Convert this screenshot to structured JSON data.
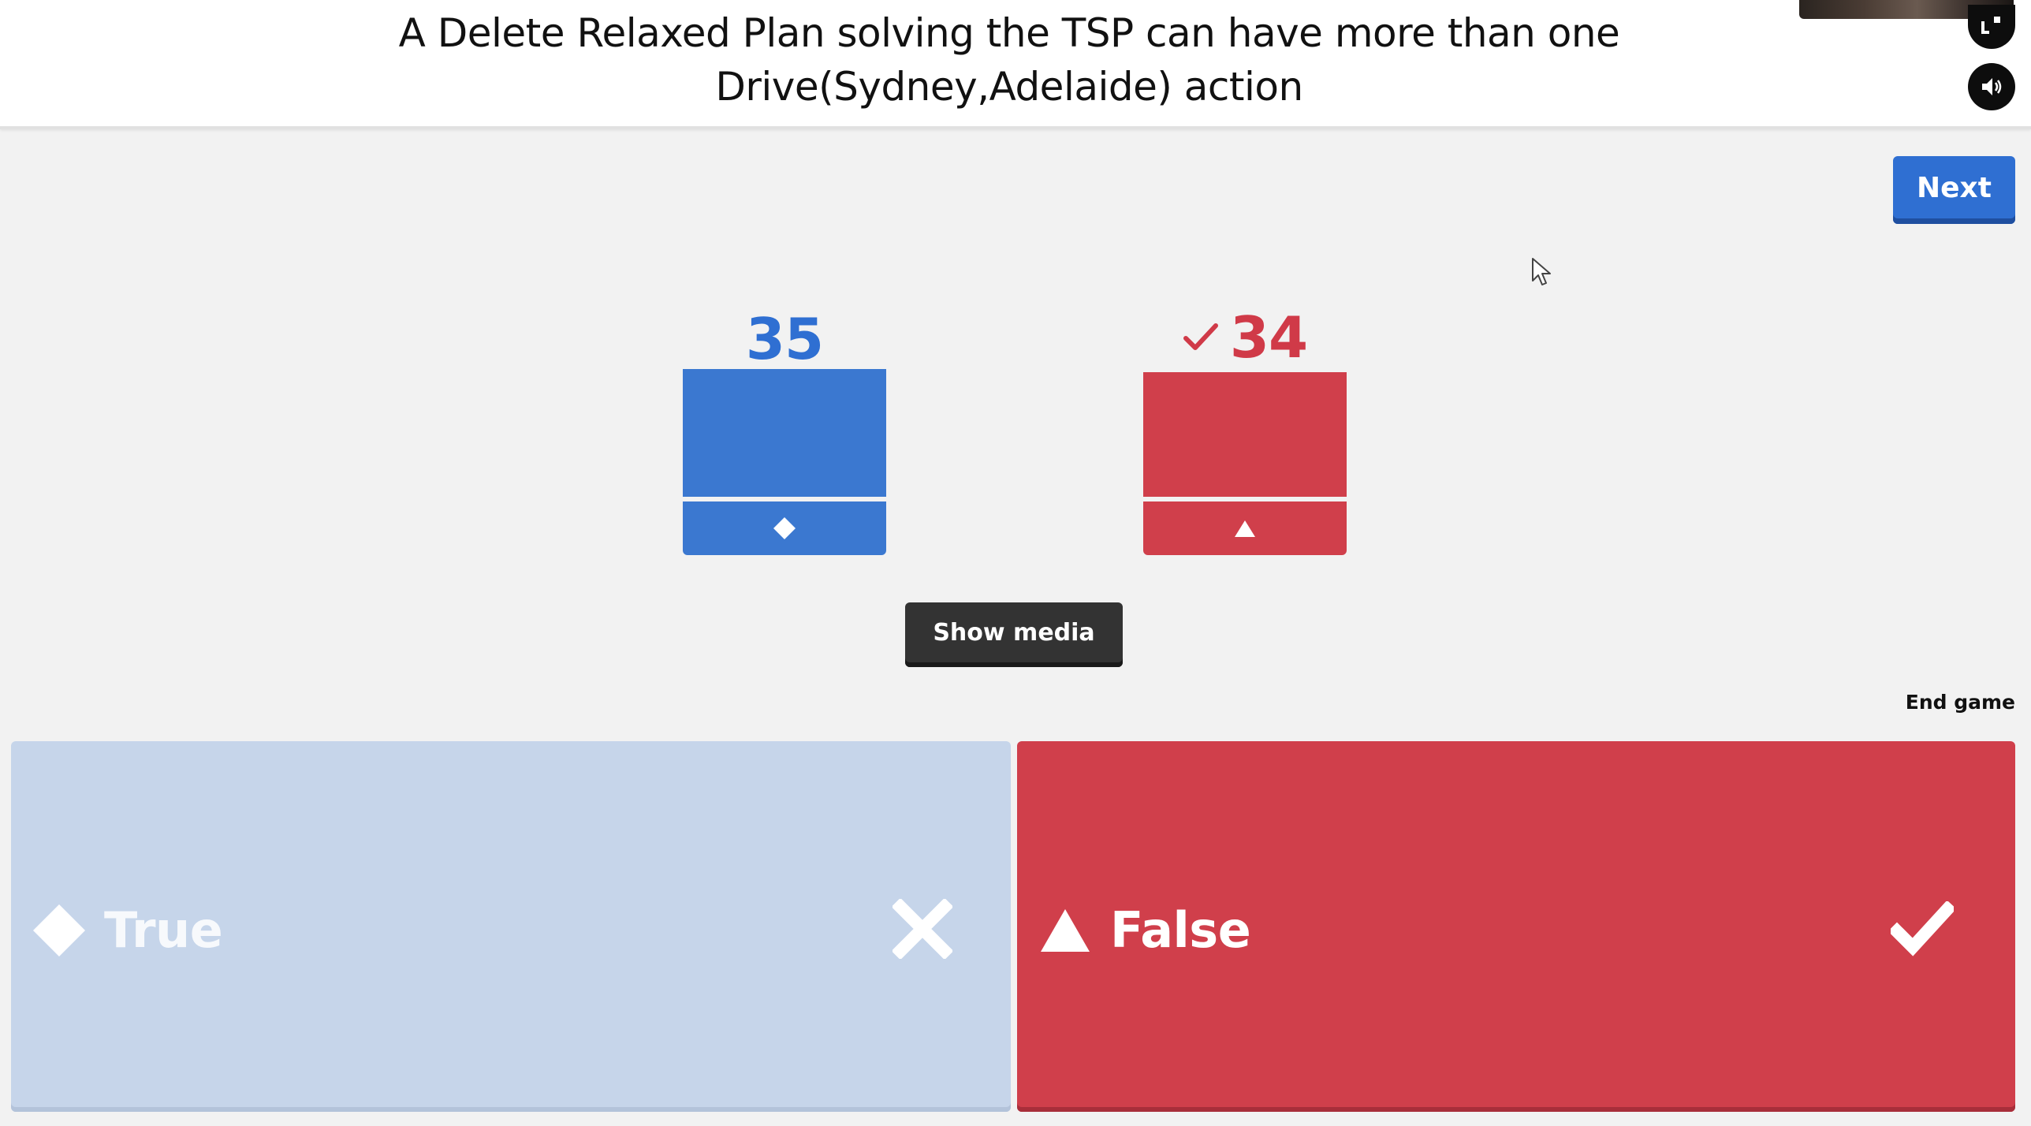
{
  "question": {
    "text": "A Delete Relaxed Plan solving the TSP can have more than one Drive(Sydney,Adelaide) action"
  },
  "header_controls": {
    "fullscreen_icon": "fullscreen-icon",
    "sound_icon": "speaker-icon"
  },
  "toolbar": {
    "next_label": "Next",
    "show_media_label": "Show media",
    "end_game_label": "End game"
  },
  "results": [
    {
      "shape": "diamond",
      "count": "35",
      "color": "#3b78d0",
      "correct": false
    },
    {
      "shape": "triangle",
      "count": "34",
      "color": "#d03f4b",
      "correct": true
    }
  ],
  "answers": [
    {
      "shape": "diamond",
      "label": "True",
      "mark": "cross-icon",
      "correct": false,
      "color": "#c6d5ea"
    },
    {
      "shape": "triangle",
      "label": "False",
      "mark": "check-icon",
      "correct": true,
      "color": "#d03f4b"
    }
  ],
  "colors": {
    "blue": "#2f6fd2",
    "red": "#d03f4b",
    "dark_button": "#333333"
  }
}
